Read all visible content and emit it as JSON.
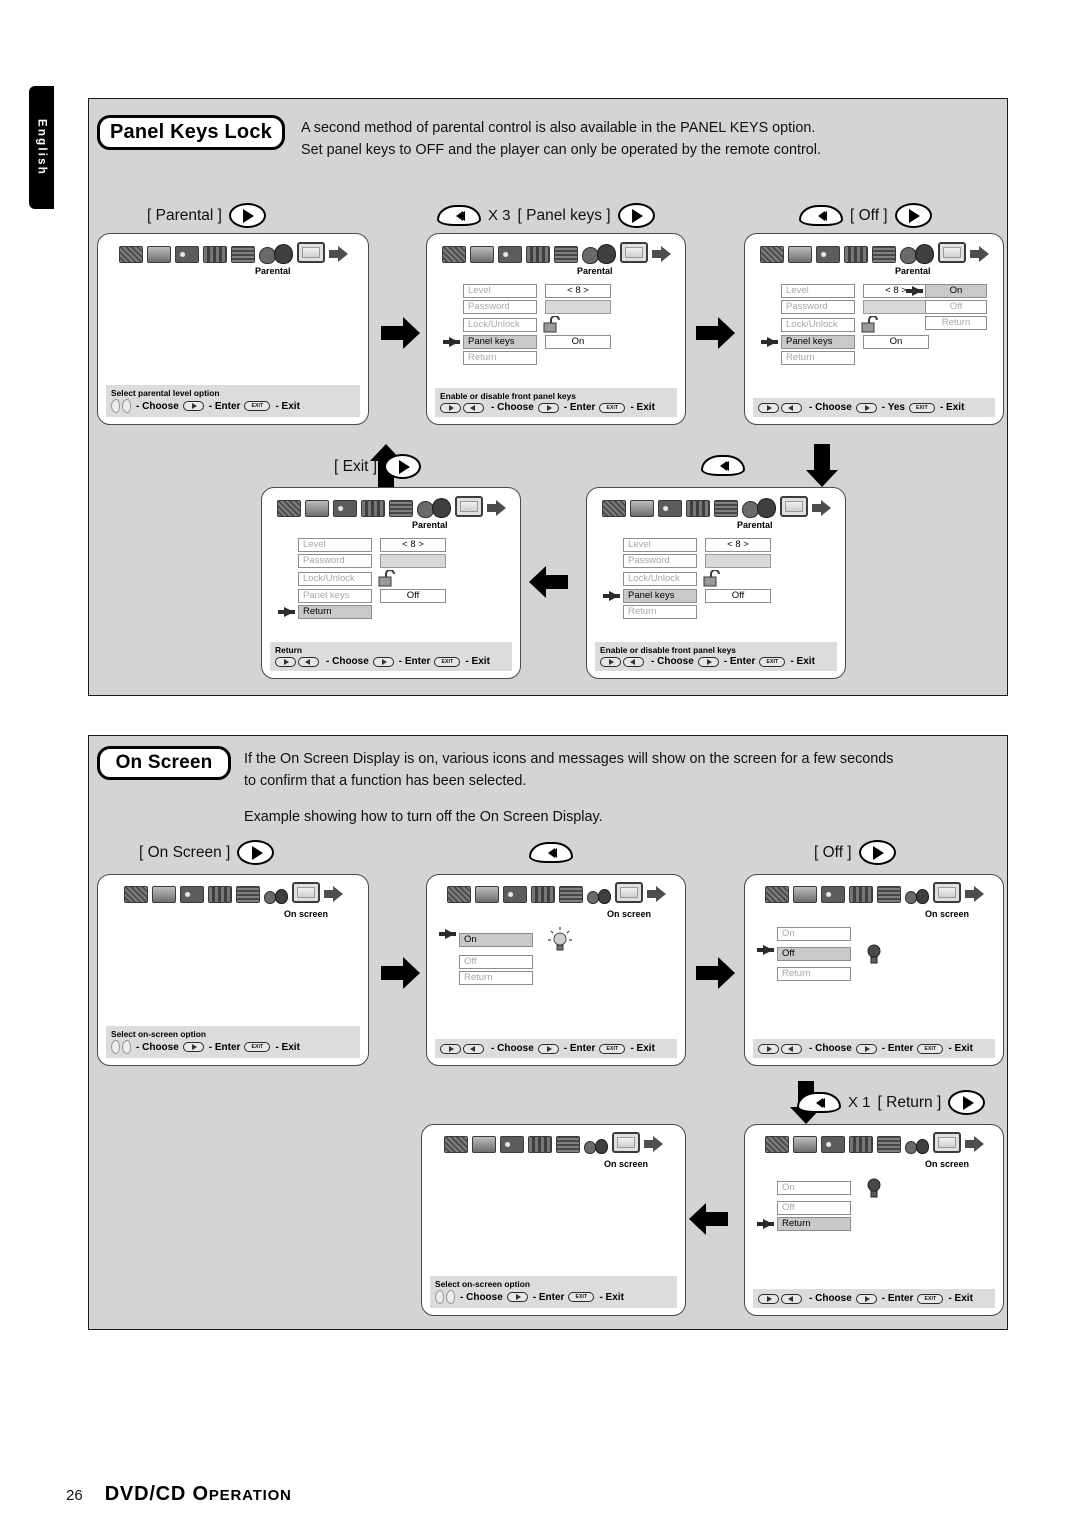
{
  "page": {
    "language_tab": "English",
    "footer_page_number": "26",
    "footer_title_main": "DVD/CD O",
    "footer_title_smallcaps": "PERATION"
  },
  "sections": [
    {
      "id": "panel-keys-lock",
      "badge": "Panel Keys Lock",
      "intro": "A second method of parental control is also available in the PANEL KEYS option.\nSet panel keys to OFF and the player can only be operated by the remote control."
    },
    {
      "id": "on-screen",
      "badge": "On Screen",
      "intro": "If the On Screen Display is on, various icons and messages will show on the screen for a few seconds\nto confirm that a function has been selected.",
      "example": "Example showing how to turn off the On Screen Display."
    }
  ],
  "steps": {
    "parental": {
      "label": "[ Parental ]",
      "key": "play-key"
    },
    "panel_keys": {
      "rew_key": "rewind-key",
      "multiplier": "X 3",
      "label": "[ Panel keys ]",
      "key": "play-key"
    },
    "off_top": {
      "rew_key": "rewind-key",
      "label": "[ Off ]",
      "key": "play-key"
    },
    "exit": {
      "label": "[ Exit ]",
      "key": "play-key"
    },
    "rew_only": {
      "rew_key": "rewind-key"
    },
    "on_screen": {
      "label": "[ On Screen ]",
      "key": "play-key"
    },
    "rew_only_2": {
      "rew_key": "rewind-key"
    },
    "off_bottom": {
      "label": "[ Off ]",
      "key": "play-key"
    },
    "return_step": {
      "rew_key": "rewind-key",
      "multiplier": "X 1",
      "label": "[ Return ]",
      "key": "play-key"
    }
  },
  "help": {
    "choose": "- Choose",
    "enter": "- Enter",
    "exit": "- Exit",
    "yes": "- Yes",
    "exit_button_text": "EXIT"
  },
  "screens": [
    {
      "id": "parental-root",
      "selected_icon_label": "Parental",
      "menu": [],
      "hint": "Select parental level option",
      "actions": [
        "- Choose",
        "- Enter",
        "- Exit"
      ],
      "cursor_type": "lr-pads"
    },
    {
      "id": "parental-panel-keys-on",
      "selected_icon_label": "Parental",
      "menu": [
        {
          "left": "Level",
          "right": "< 8 >",
          "left_state": "dim",
          "right_state": "active"
        },
        {
          "left": "Password",
          "right": "",
          "left_state": "dim",
          "right_state": "blank"
        },
        {
          "left": "Lock/Unlock",
          "right": "lock-open-icon",
          "left_state": "dim",
          "right_state": "icon"
        },
        {
          "left": "Panel keys",
          "right": "On",
          "left_state": "highlight",
          "right_state": "active",
          "pointer": true
        },
        {
          "left": "Return",
          "right": "",
          "left_state": "dim",
          "right_state": "none"
        }
      ],
      "hint": "Enable or disable front panel keys",
      "actions": [
        "- Choose",
        "- Enter",
        "- Exit"
      ],
      "cursor_type": "rew-ff"
    },
    {
      "id": "parental-panel-keys-submenu",
      "selected_icon_label": "Parental",
      "menu": [
        {
          "left": "Level",
          "right": "< 8 >",
          "left_state": "dim",
          "right_state": "active"
        },
        {
          "left": "Password",
          "right": "",
          "left_state": "dim",
          "right_state": "blank"
        },
        {
          "left": "Lock/Unlock",
          "right": "lock-open-icon",
          "left_state": "dim",
          "right_state": "icon"
        },
        {
          "left": "Panel keys",
          "right": "On",
          "left_state": "highlight",
          "right_state": "active",
          "pointer": true
        },
        {
          "left": "Return",
          "right": "",
          "left_state": "dim",
          "right_state": "none"
        }
      ],
      "submenu": [
        {
          "label": "On",
          "state": "highlight",
          "pointer": true
        },
        {
          "label": "Off",
          "state": "dim"
        },
        {
          "label": "Return",
          "state": "dim"
        }
      ],
      "hint": "",
      "actions": [
        "- Choose",
        "- Yes",
        "- Exit"
      ],
      "cursor_type": "rew-ff"
    },
    {
      "id": "parental-panel-keys-off",
      "selected_icon_label": "Parental",
      "menu": [
        {
          "left": "Level",
          "right": "< 8 >",
          "left_state": "dim",
          "right_state": "active"
        },
        {
          "left": "Password",
          "right": "",
          "left_state": "dim",
          "right_state": "blank"
        },
        {
          "left": "Lock/Unlock",
          "right": "lock-open-icon",
          "left_state": "dim",
          "right_state": "icon"
        },
        {
          "left": "Panel keys",
          "right": "Off",
          "left_state": "highlight",
          "right_state": "active",
          "pointer": true
        },
        {
          "left": "Return",
          "right": "",
          "left_state": "dim",
          "right_state": "none"
        }
      ],
      "hint": "Enable or disable front panel keys",
      "actions": [
        "- Choose",
        "- Enter",
        "- Exit"
      ],
      "cursor_type": "rew-ff"
    },
    {
      "id": "parental-return-selected",
      "selected_icon_label": "Parental",
      "menu": [
        {
          "left": "Level",
          "right": "< 8 >",
          "left_state": "dim",
          "right_state": "active"
        },
        {
          "left": "Password",
          "right": "",
          "left_state": "dim",
          "right_state": "blank"
        },
        {
          "left": "Lock/Unlock",
          "right": "lock-open-icon",
          "left_state": "dim",
          "right_state": "icon"
        },
        {
          "left": "Panel keys",
          "right": "Off",
          "left_state": "dim",
          "right_state": "active"
        },
        {
          "left": "Return",
          "right": "",
          "left_state": "highlight",
          "right_state": "none",
          "pointer": true
        }
      ],
      "hint": "Return",
      "actions": [
        "- Choose",
        "- Enter",
        "- Exit"
      ],
      "cursor_type": "rew-ff"
    },
    {
      "id": "on-screen-root",
      "selected_icon_label": "On screen",
      "menu": [],
      "hint": "Select on-screen option",
      "actions": [
        "- Choose",
        "- Enter",
        "- Exit"
      ],
      "cursor_type": "lr-pads"
    },
    {
      "id": "on-screen-on",
      "selected_icon_label": "On screen",
      "submenu": [
        {
          "label": "On",
          "state": "highlight",
          "pointer": true
        },
        {
          "label": "Off",
          "state": "dim"
        },
        {
          "label": "Return",
          "state": "dim"
        }
      ],
      "side_icon": "bulb-on-icon",
      "hint": "",
      "actions": [
        "- Choose",
        "- Enter",
        "- Exit"
      ],
      "cursor_type": "rew-ff"
    },
    {
      "id": "on-screen-off",
      "selected_icon_label": "On screen",
      "submenu": [
        {
          "label": "On",
          "state": "dim"
        },
        {
          "label": "Off",
          "state": "highlight",
          "pointer": true
        },
        {
          "label": "Return",
          "state": "dim"
        }
      ],
      "side_icon": "bulb-off-icon",
      "hint": "",
      "actions": [
        "- Choose",
        "- Enter",
        "- Exit"
      ],
      "cursor_type": "rew-ff"
    },
    {
      "id": "on-screen-return",
      "selected_icon_label": "On screen",
      "submenu": [
        {
          "label": "On",
          "state": "dim"
        },
        {
          "label": "Off",
          "state": "dim"
        },
        {
          "label": "Return",
          "state": "highlight",
          "pointer": true
        }
      ],
      "side_icon": "bulb-off-icon",
      "hint": "",
      "actions": [
        "- Choose",
        "- Enter",
        "- Exit"
      ],
      "cursor_type": "rew-ff"
    },
    {
      "id": "on-screen-root-2",
      "selected_icon_label": "On screen",
      "menu": [],
      "hint": "Select on-screen option",
      "actions": [
        "- Choose",
        "- Enter",
        "- Exit"
      ],
      "cursor_type": "lr-pads"
    }
  ],
  "colors": {
    "section_bg": "#d4d4d4",
    "help_bar_bg": "#dcdcdc",
    "highlight_bg": "#c9c9c9",
    "dim_text": "#a8a8a8",
    "border": "#1a1a1a"
  }
}
